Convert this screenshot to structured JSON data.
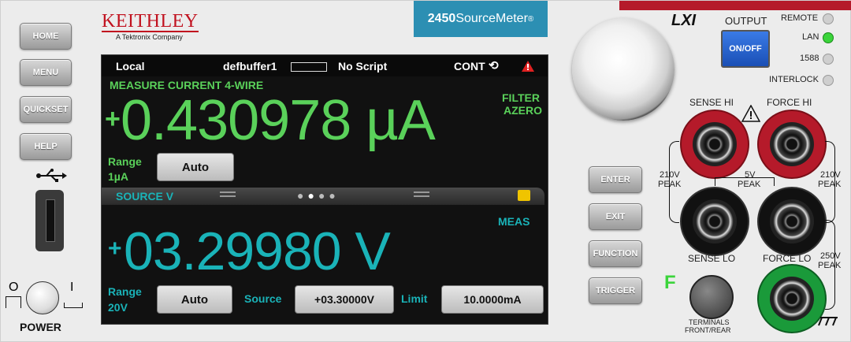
{
  "left_buttons": [
    {
      "label": "HOME"
    },
    {
      "label": "MENU"
    },
    {
      "label": "QUICKSET"
    },
    {
      "label": "HELP"
    }
  ],
  "brand": {
    "name": "KEITHLEY",
    "sub": "A Tektronix Company",
    "model_prefix": "2450",
    "model_rest": " SourceMeter",
    "reg": "®",
    "lxi": "LXI"
  },
  "power": {
    "label": "POWER",
    "off_symbol": "O",
    "on_symbol": "I"
  },
  "screen": {
    "top": {
      "local": "Local",
      "buffer": "defbuffer1",
      "script": "No Script",
      "trigger": "CONT"
    },
    "measure": {
      "title": "MEASURE CURRENT 4-WIRE",
      "sign": "+",
      "value": "0.430978 µA",
      "filter": "FILTER",
      "azero": "AZERO",
      "range_label": "Range",
      "range_value": "1µA",
      "range_button": "Auto"
    },
    "source": {
      "title": "SOURCE V",
      "meas": "MEAS",
      "sign": "+",
      "value": "03.29980 V",
      "range_label": "Range",
      "range_value": "20V",
      "range_button": "Auto",
      "source_label": "Source",
      "source_value": "+03.30000V",
      "limit_label": "Limit",
      "limit_value": "10.0000mA"
    }
  },
  "right_buttons": [
    {
      "label": "ENTER"
    },
    {
      "label": "EXIT"
    },
    {
      "label": "FUNCTION"
    },
    {
      "label": "TRIGGER"
    }
  ],
  "output": {
    "title": "OUTPUT",
    "button": "ON/OFF"
  },
  "indicators": [
    {
      "label": "REMOTE",
      "color": "#cfcfcf"
    },
    {
      "label": "LAN",
      "color": "#3bd43b"
    },
    {
      "label": "1588",
      "color": "#cfcfcf"
    },
    {
      "label": "INTERLOCK",
      "color": "#cfcfcf"
    }
  ],
  "terminals": {
    "sense_hi": "SENSE HI",
    "force_hi": "FORCE HI",
    "sense_lo": "SENSE LO",
    "force_lo": "FORCE LO",
    "peak_left_v": "210V",
    "peak_left_p": "PEAK",
    "peak_right_v": "210V",
    "peak_right_p": "PEAK",
    "peak_mid_v": "5V",
    "peak_mid_p": "PEAK",
    "peak_lo_v": "250V",
    "peak_lo_p": "PEAK",
    "front_rear_1": "TERMINALS",
    "front_rear_2": "FRONT/REAR",
    "front_indicator": "F"
  },
  "colors": {
    "measure": "#5ad15a",
    "source": "#1ab3b8",
    "brand_red": "#c1121f",
    "output_blue": "#1f5fd0"
  }
}
